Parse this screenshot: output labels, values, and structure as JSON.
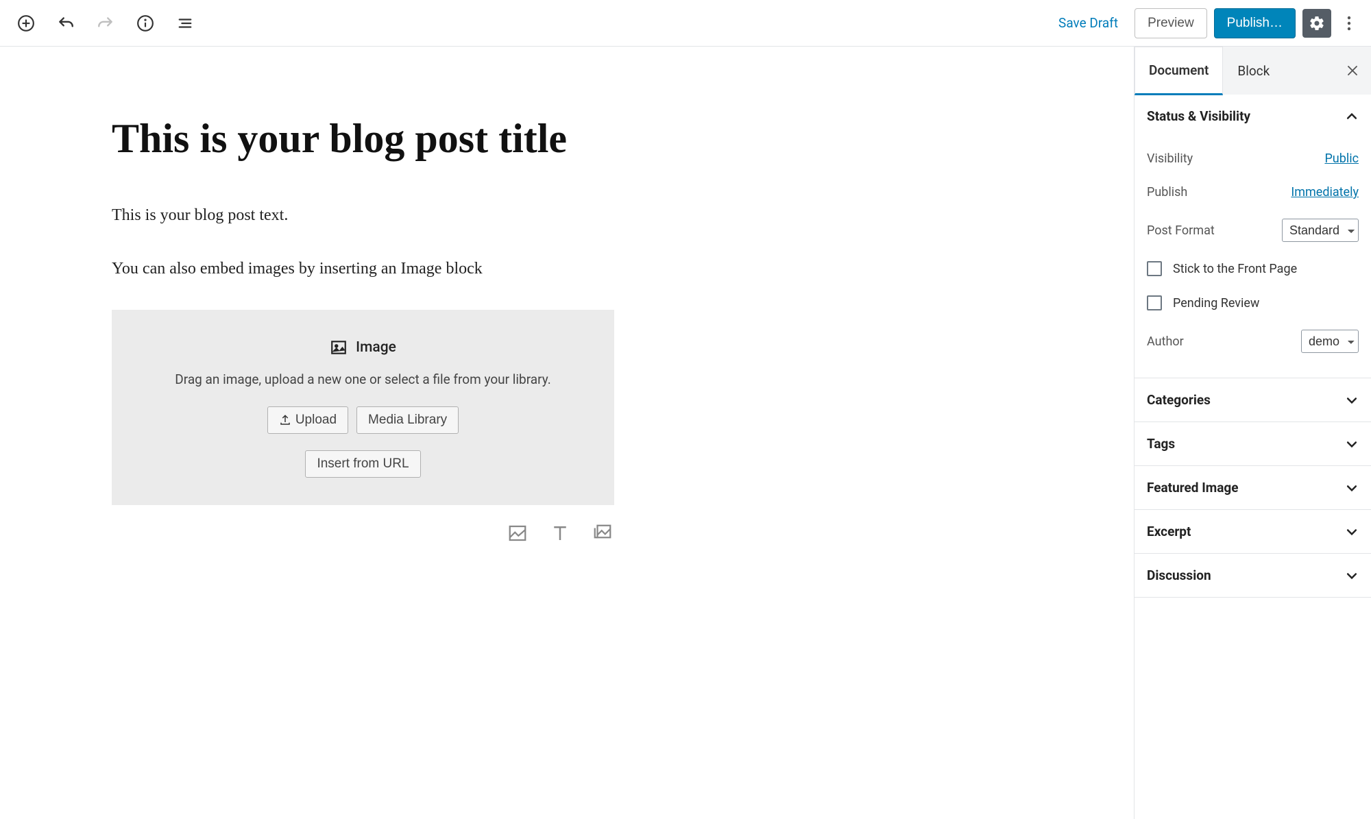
{
  "toolbar": {
    "save_draft": "Save Draft",
    "preview": "Preview",
    "publish": "Publish…"
  },
  "editor": {
    "title": "This is your blog post title",
    "paragraph1": "This is your blog post text.",
    "paragraph2": "You can also embed images by inserting an Image block",
    "image_block": {
      "label": "Image",
      "description": "Drag an image, upload a new one or select a file from your library.",
      "upload": "Upload",
      "media_library": "Media Library",
      "insert_url": "Insert from URL"
    }
  },
  "sidebar": {
    "tabs": {
      "document": "Document",
      "block": "Block"
    },
    "status_visibility": {
      "title": "Status & Visibility",
      "visibility_label": "Visibility",
      "visibility_value": "Public",
      "publish_label": "Publish",
      "publish_value": "Immediately",
      "post_format_label": "Post Format",
      "post_format_value": "Standard",
      "stick_label": "Stick to the Front Page",
      "pending_label": "Pending Review",
      "author_label": "Author",
      "author_value": "demo"
    },
    "panels": {
      "categories": "Categories",
      "tags": "Tags",
      "featured_image": "Featured Image",
      "excerpt": "Excerpt",
      "discussion": "Discussion"
    }
  }
}
